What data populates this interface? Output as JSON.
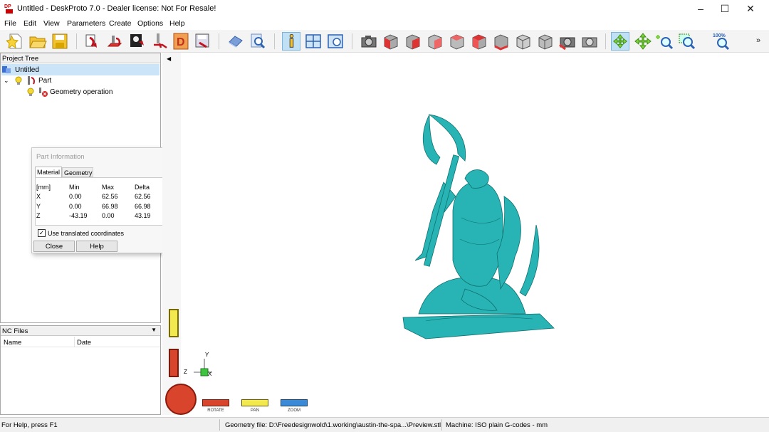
{
  "window": {
    "title": "Untitled - DeskProto 7.0 - Dealer license: Not For Resale!",
    "app_icon_text": "DP"
  },
  "menu": [
    "File",
    "Edit",
    "View",
    "Parameters",
    "Create",
    "Options",
    "Help"
  ],
  "toolbar": {
    "zoom_level": "100%",
    "buttons": [
      "new-file",
      "open-folder",
      "save",
      "part-wizard",
      "vector-wizard",
      "bitmap-wizard",
      "operation-wizard",
      "drawing",
      "save-toolpath",
      "eraser",
      "find",
      "info",
      "layout",
      "properties",
      "snapshot",
      "view-front",
      "view-back",
      "view-left",
      "view-right",
      "view-top",
      "view-bottom",
      "view-iso",
      "view-iso2",
      "reset-view",
      "settings-view",
      "rotate",
      "pan",
      "zoom-in",
      "zoom-window",
      "zoom-fit"
    ]
  },
  "project_tree": {
    "header": "Project Tree",
    "items": [
      {
        "label": "Untitled",
        "level": 0,
        "selected": true
      },
      {
        "label": "Part",
        "level": 1
      },
      {
        "label": "Geometry operation",
        "level": 2
      }
    ]
  },
  "nc_files": {
    "header": "NC Files",
    "columns": [
      "Name",
      "Date"
    ]
  },
  "part_info": {
    "title": "Part Information",
    "tabs": [
      "Material",
      "Geometry"
    ],
    "active_tab": "Material",
    "header": [
      "[mm]",
      "Min",
      "Max",
      "Delta"
    ],
    "rows": [
      [
        "X",
        "0.00",
        "62.56",
        "62.56"
      ],
      [
        "Y",
        "0.00",
        "66.98",
        "66.98"
      ],
      [
        "Z",
        "-43.19",
        "0.00",
        "43.19"
      ]
    ],
    "checkbox_label": "Use translated coordinates",
    "checkbox_checked": true,
    "close_label": "Close",
    "help_label": "Help"
  },
  "viewport": {
    "model_color": "#28b4b4",
    "axis_x": "X",
    "axis_y": "Y",
    "axis_z": "Z",
    "nav": {
      "rotate": "ROTATE",
      "pan": "PAN",
      "zoom": "ZOOM"
    }
  },
  "status": {
    "help": "For Help, press F1",
    "geometry_file": "Geometry file: D:\\Freedesignwold\\1.working\\austin-the-spa...\\Preview.stl",
    "machine": "Machine: ISO plain G-codes - mm"
  }
}
